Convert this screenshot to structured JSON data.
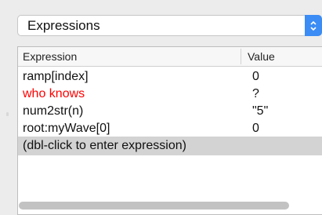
{
  "popup": {
    "selected": "Expressions"
  },
  "table": {
    "headers": [
      "Expression",
      "Value"
    ],
    "rows": [
      {
        "expression": "ramp[index]",
        "value": "0",
        "color": "#111111"
      },
      {
        "expression": "who knows",
        "value": "?",
        "color": "#ff0000"
      },
      {
        "expression": "num2str(n)",
        "value": "\"5\"",
        "color": "#111111"
      },
      {
        "expression": "root:myWave[0]",
        "value": "0",
        "color": "#111111"
      },
      {
        "expression": "(dbl-click to enter expression)",
        "value": "",
        "color": "#111111"
      }
    ]
  },
  "colors": {
    "accent": "#3b8cf5",
    "error_text": "#ff0000",
    "selected_row": "#d3d3d3"
  }
}
